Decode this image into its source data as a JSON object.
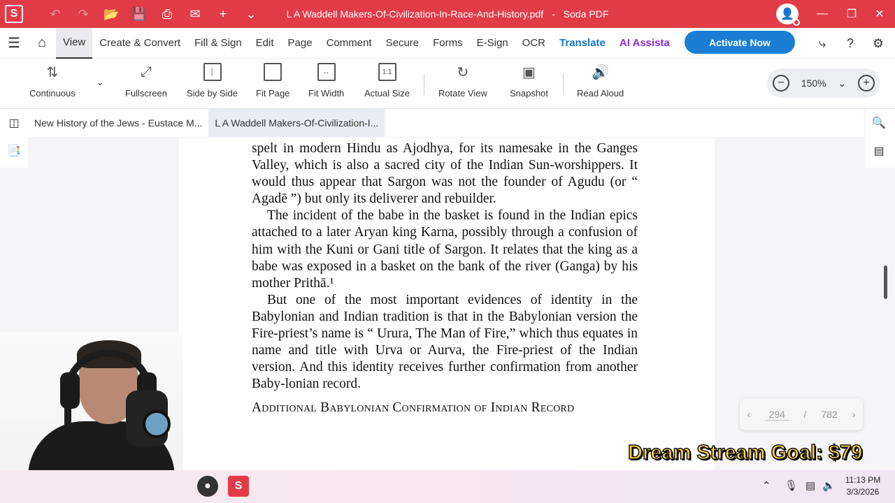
{
  "window": {
    "title": "L A Waddell Makers-Of-Civilization-In-Race-And-History.pdf",
    "separator": "-",
    "app_name": "Soda PDF",
    "logo_letter": "S"
  },
  "menu": {
    "items": [
      {
        "label": "View"
      },
      {
        "label": "Create & Convert"
      },
      {
        "label": "Fill & Sign"
      },
      {
        "label": "Edit"
      },
      {
        "label": "Page"
      },
      {
        "label": "Comment"
      },
      {
        "label": "Secure"
      },
      {
        "label": "Forms"
      },
      {
        "label": "E-Sign"
      },
      {
        "label": "OCR"
      },
      {
        "label": "Translate"
      },
      {
        "label": "AI Assista"
      }
    ],
    "activate_label": "Activate Now"
  },
  "toolbar": {
    "tools": [
      {
        "label": "Continuous",
        "icon": "continuous-icon"
      },
      {
        "label": "Fullscreen",
        "icon": "fullscreen-icon"
      },
      {
        "label": "Side by Side",
        "icon": "side-by-side-icon"
      },
      {
        "label": "Fit Page",
        "icon": "fit-page-icon"
      },
      {
        "label": "Fit Width",
        "icon": "fit-width-icon"
      },
      {
        "label": "Actual Size",
        "icon": "actual-size-icon"
      },
      {
        "label": "Rotate View",
        "icon": "rotate-icon"
      },
      {
        "label": "Snapshot",
        "icon": "camera-icon"
      },
      {
        "label": "Read Aloud",
        "icon": "speaker-icon"
      }
    ],
    "zoom": "150%",
    "actual_size_glyph": "1:1"
  },
  "tabs": [
    {
      "label": "New History of the Jews - Eustace M..."
    },
    {
      "label": "L A Waddell Makers-Of-Civilization-I..."
    }
  ],
  "document": {
    "paragraphs": [
      "spelt in modern Hindu as Ajodhya, for its namesake in the Ganges Valley, which is also a sacred city of the Indian Sun-worshippers. It would thus appear that Sargon was not the founder of Agudu (or “ Agadē ”) but only its deliverer and rebuilder.",
      "The incident of the babe in the basket is found in the Indian epics attached to a later Aryan king Karna, possibly through a confusion of him with the Kuni or Gani title of Sargon. It relates that the king as a babe was exposed in a basket on the bank of the river (Ganga) by his mother Prithā.¹",
      "But one of the most important evidences of identity in the Babylonian and Indian tradition is that in the Babylonian version the Fire-priest’s name is “ Urura, The Man of Fire,” which thus equates in name and title with Urva or Aurva, the Fire-priest of the Indian version. And this identity receives further confirmation from another Baby-lonian record."
    ],
    "heading": "Additional Babylonian Confirmation of Indian Record"
  },
  "page_nav": {
    "current": "294",
    "slash": "/",
    "total": "782"
  },
  "overlay": {
    "stream_goal": "Dream Stream Goal: $79"
  },
  "taskbar": {
    "time": "11:13 PM",
    "date": "3/3/2026"
  },
  "colors": {
    "titlebar": "#e13b48",
    "activate": "#1a7fd4",
    "translate": "#1577c8",
    "ai": "#8a2fd0"
  }
}
